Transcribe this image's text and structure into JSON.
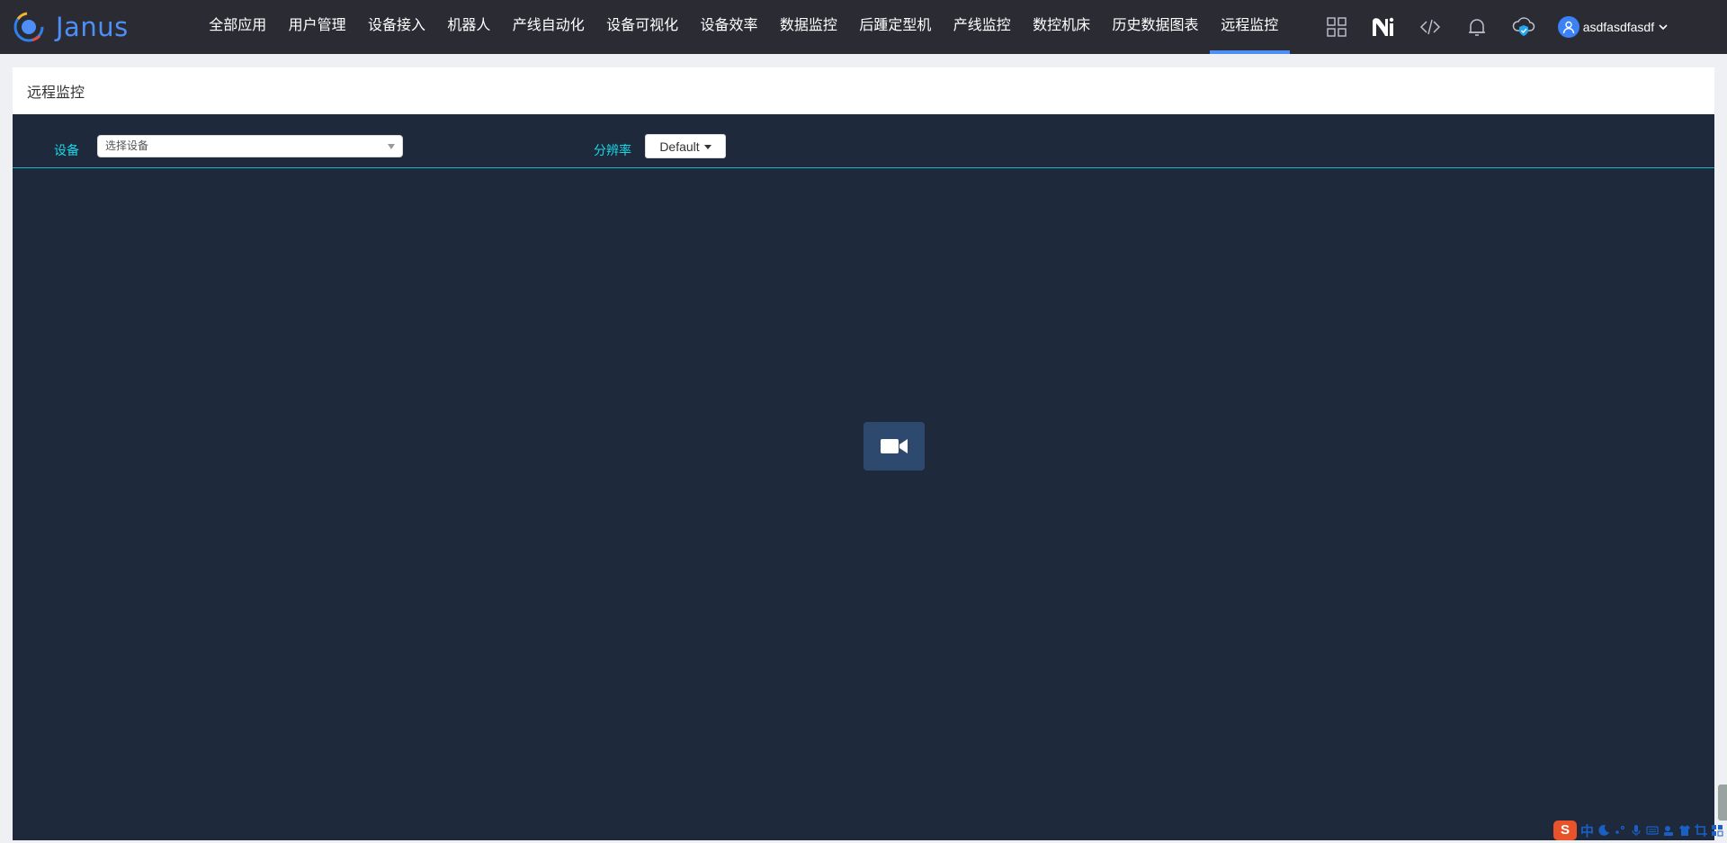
{
  "app": {
    "name": "Janus"
  },
  "nav": {
    "items": [
      {
        "label": "全部应用"
      },
      {
        "label": "用户管理"
      },
      {
        "label": "设备接入"
      },
      {
        "label": "机器人"
      },
      {
        "label": "产线自动化"
      },
      {
        "label": "设备可视化"
      },
      {
        "label": "设备效率"
      },
      {
        "label": "数据监控"
      },
      {
        "label": "后踵定型机"
      },
      {
        "label": "产线监控"
      },
      {
        "label": "数控机床"
      },
      {
        "label": "历史数据图表"
      },
      {
        "label": "远程监控",
        "active": true
      }
    ]
  },
  "tools": [
    "grid-icon",
    "ni-logo-icon",
    "code-icon",
    "bell-icon",
    "cloud-shield-icon"
  ],
  "user": {
    "name": "asdfasdfasdf"
  },
  "page": {
    "title": "远程监控"
  },
  "controls": {
    "device_label": "设备",
    "device_placeholder": "选择设备",
    "resolution_label": "分辨率",
    "resolution_value": "Default"
  },
  "ime": {
    "brand": "S",
    "mode": "中"
  },
  "colors": {
    "topbar": "#2b2c33",
    "accent": "#4d8ff7",
    "panel": "#1e293c",
    "label_cyan": "#19d8e6",
    "video_tile": "#2d4a6e"
  }
}
